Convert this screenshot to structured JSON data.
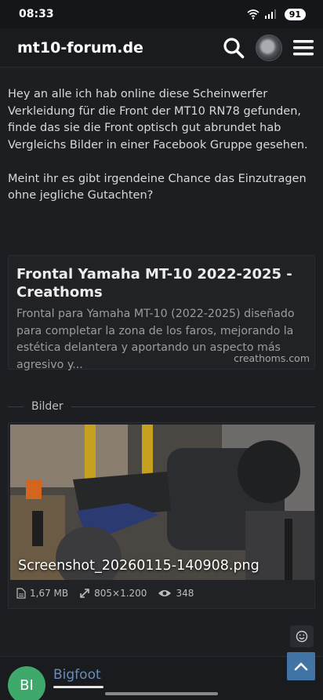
{
  "status_bar": {
    "time": "08:33",
    "battery": "91"
  },
  "header": {
    "title": "mt10-forum.de"
  },
  "post": {
    "paragraphs": [
      "Hey an alle ich hab online diese Scheinwerfer Verkleidung für die Front der MT10 RN78 gefunden, finde das sie die Front optisch gut abrundet hab Vergleichs Bilder in einer Facebook Gruppe gesehen.",
      "Meint ihr es gibt irgendeine Chance das Einzutragen ohne jegliche Gutachten?"
    ]
  },
  "embed": {
    "title": "Frontal Yamaha MT-10 2022-2025 - Creathoms",
    "description": "Frontal para Yamaha MT-10 (2022-2025) diseñado para completar la zona de los faros, mejorando la estética delantera y aportando un aspecto más agresivo y...",
    "domain": "creathoms.com"
  },
  "attachments": {
    "section_label": "Bilder",
    "item": {
      "filename": "Screenshot_20260115-140908.png",
      "size": "1,67 MB",
      "dimensions": "805×1.200",
      "views": "348"
    }
  },
  "footer": {
    "initials": "BI",
    "username": "Bigfoot"
  },
  "colors": {
    "accent": "#3f74a4",
    "avatar_bg": "#3fa96c",
    "username": "#6b8cb8"
  }
}
